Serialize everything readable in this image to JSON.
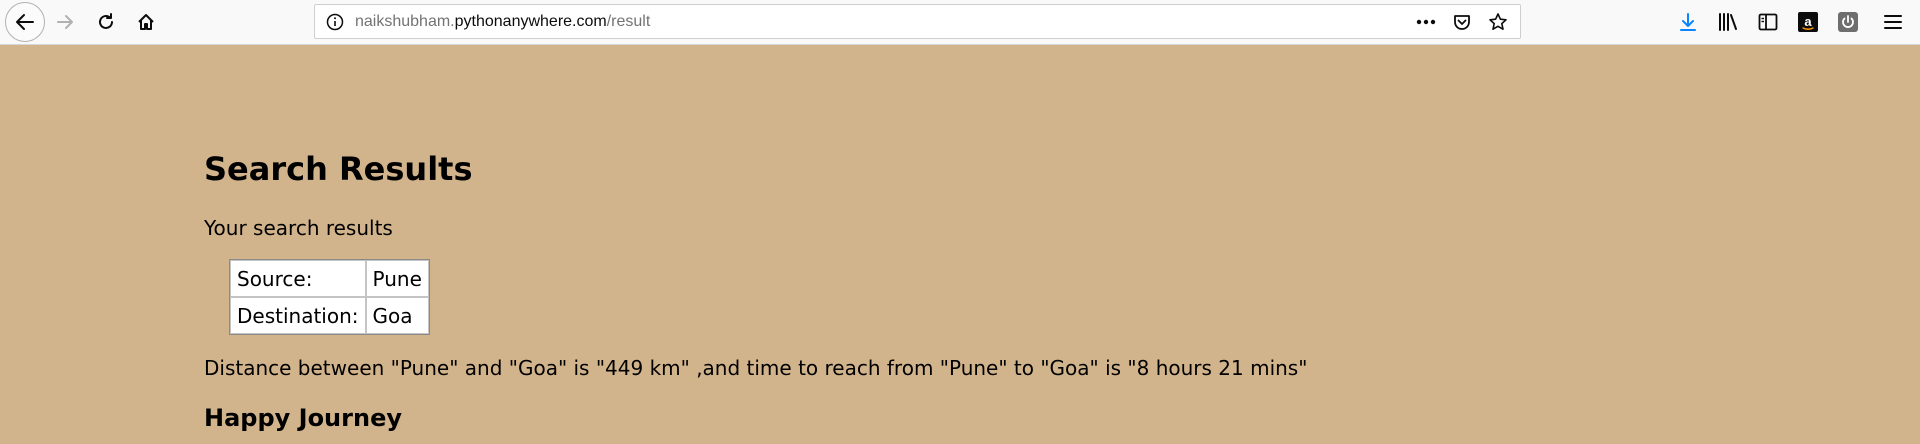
{
  "browser": {
    "url": {
      "prefix": "naikshubham.",
      "host": "pythonanywhere.com",
      "path": "/result"
    },
    "icons": {
      "back": "back-arrow-icon",
      "forward": "forward-arrow-icon",
      "reload": "reload-icon",
      "home": "home-icon",
      "info": "info-icon",
      "more": "more-dots-icon",
      "pocket": "pocket-icon",
      "bookmark": "star-icon",
      "downloads": "download-arrow-icon",
      "library": "library-icon",
      "sidebar": "sidebar-icon",
      "amazon": "amazon-icon",
      "power": "power-icon",
      "menu": "hamburger-menu-icon"
    },
    "colors": {
      "toolbar_bg": "#f9f9fa",
      "download_accent": "#0a84ff"
    }
  },
  "page": {
    "background": "#d2b48c",
    "title": "Search Results",
    "subtitle": "Your search results",
    "table": [
      {
        "label": "Source:",
        "value": "Pune"
      },
      {
        "label": "Destination:",
        "value": "Goa"
      }
    ],
    "distance_text": "Distance between \"Pune\" and \"Goa\" is \"449 km\" ,and time to reach from \"Pune\" to \"Goa\" is \"8 hours 21 mins\"",
    "closing": "Happy Journey"
  }
}
